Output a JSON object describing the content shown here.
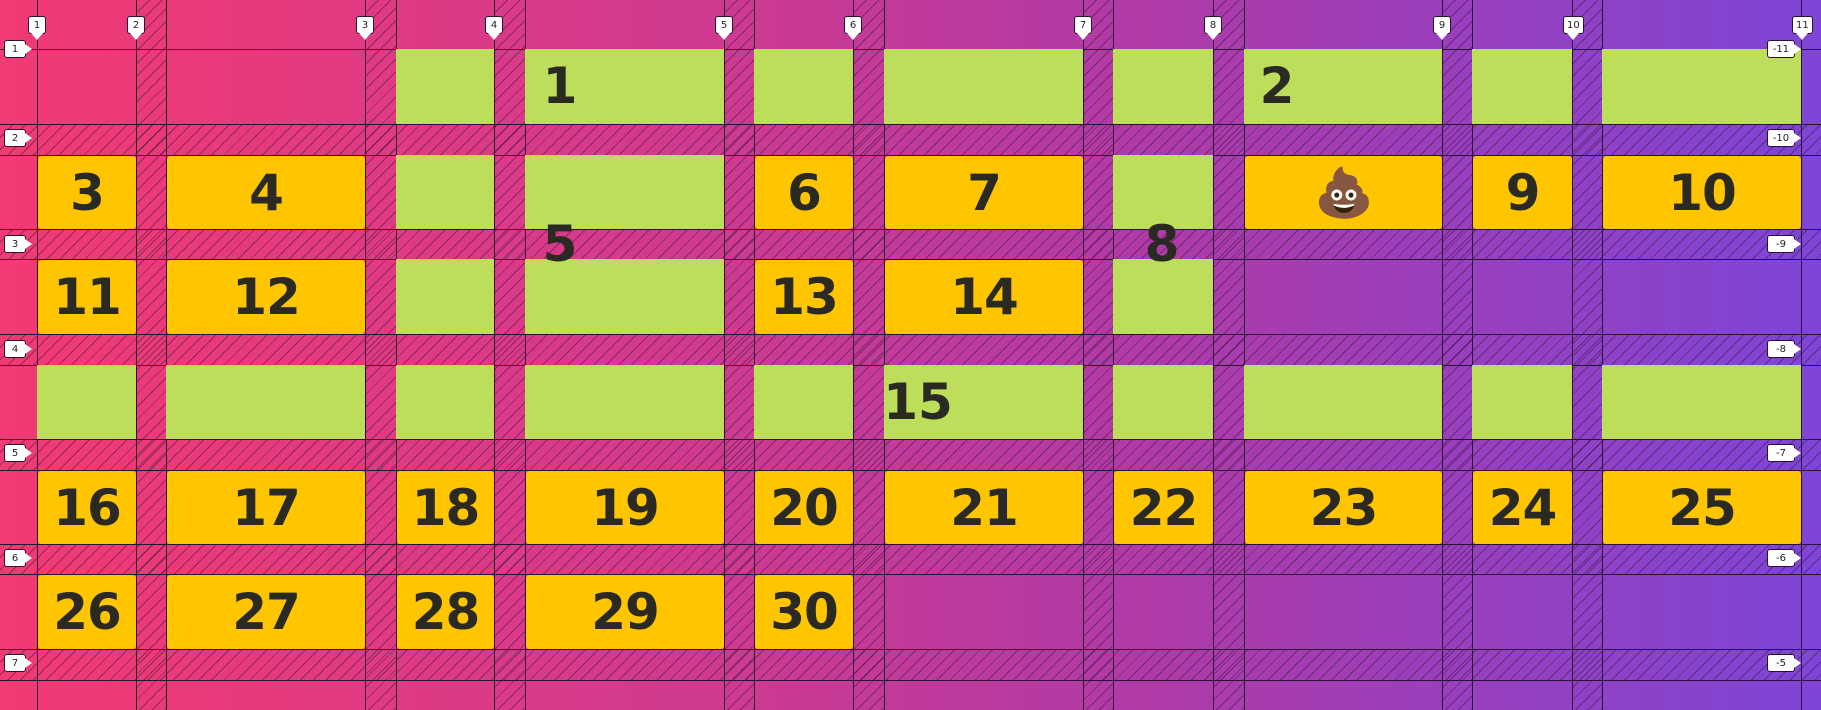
{
  "column_lines": [
    "1",
    "2",
    "3",
    "4",
    "5",
    "6",
    "7",
    "8",
    "9",
    "10",
    "11"
  ],
  "row_lines_start": [
    "1",
    "2",
    "3",
    "4",
    "5",
    "6",
    "7"
  ],
  "row_lines_end": [
    "-11",
    "-10",
    "-9",
    "-8",
    "-7",
    "-6",
    "-5"
  ],
  "items": [
    {
      "id": "1",
      "label": "1",
      "color": "green"
    },
    {
      "id": "2",
      "label": "2",
      "color": "green"
    },
    {
      "id": "3",
      "label": "3",
      "color": "yellow"
    },
    {
      "id": "4",
      "label": "4",
      "color": "yellow"
    },
    {
      "id": "5",
      "label": "5",
      "color": "green"
    },
    {
      "id": "6",
      "label": "6",
      "color": "yellow"
    },
    {
      "id": "7",
      "label": "7",
      "color": "yellow"
    },
    {
      "id": "8",
      "label": "8",
      "color": "green"
    },
    {
      "id": "poop",
      "label": "💩",
      "color": "yellow",
      "icon": "pile-of-poo-emoji"
    },
    {
      "id": "9",
      "label": "9",
      "color": "yellow"
    },
    {
      "id": "10",
      "label": "10",
      "color": "yellow"
    },
    {
      "id": "11",
      "label": "11",
      "color": "yellow"
    },
    {
      "id": "12",
      "label": "12",
      "color": "yellow"
    },
    {
      "id": "13",
      "label": "13",
      "color": "yellow"
    },
    {
      "id": "14",
      "label": "14",
      "color": "yellow"
    },
    {
      "id": "15",
      "label": "15",
      "color": "green"
    },
    {
      "id": "16",
      "label": "16",
      "color": "yellow"
    },
    {
      "id": "17",
      "label": "17",
      "color": "yellow"
    },
    {
      "id": "18",
      "label": "18",
      "color": "yellow"
    },
    {
      "id": "19",
      "label": "19",
      "color": "yellow"
    },
    {
      "id": "20",
      "label": "20",
      "color": "yellow"
    },
    {
      "id": "21",
      "label": "21",
      "color": "yellow"
    },
    {
      "id": "22",
      "label": "22",
      "color": "yellow"
    },
    {
      "id": "23",
      "label": "23",
      "color": "yellow"
    },
    {
      "id": "24",
      "label": "24",
      "color": "yellow"
    },
    {
      "id": "25",
      "label": "25",
      "color": "yellow"
    },
    {
      "id": "26",
      "label": "26",
      "color": "yellow"
    },
    {
      "id": "27",
      "label": "27",
      "color": "yellow"
    },
    {
      "id": "28",
      "label": "28",
      "color": "yellow"
    },
    {
      "id": "29",
      "label": "29",
      "color": "yellow"
    },
    {
      "id": "30",
      "label": "30",
      "color": "yellow"
    }
  ],
  "colors": {
    "item_yellow": "#ffc600",
    "item_green": "#bdde5a",
    "background_start": "#f23a73",
    "background_end": "#7e45d6",
    "grid_line": "#2a1236"
  }
}
